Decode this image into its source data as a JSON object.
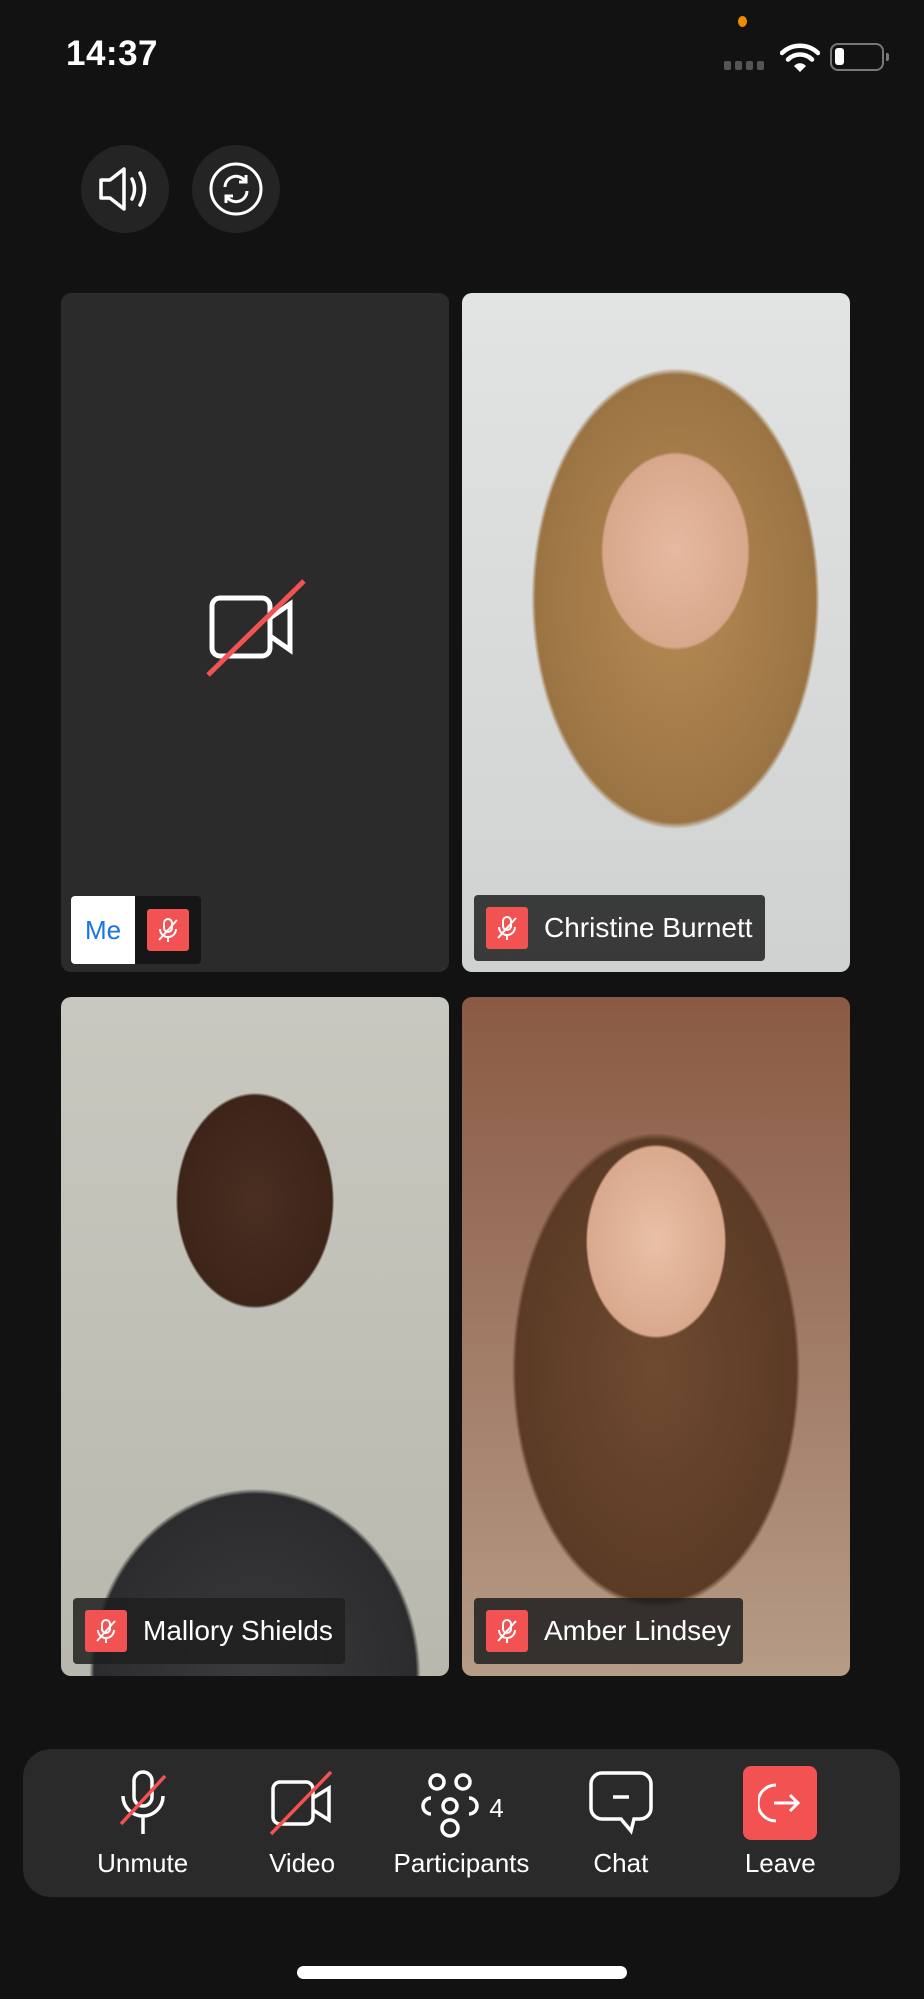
{
  "status_bar": {
    "time": "14:37",
    "icons": [
      "signal-icon",
      "wifi-icon",
      "battery-icon"
    ],
    "battery_level": 0.15
  },
  "top_controls": [
    {
      "icon": "speaker-icon"
    },
    {
      "icon": "switch-camera-icon"
    }
  ],
  "tiles": [
    {
      "name": "Me",
      "video": false,
      "muted": true
    },
    {
      "name": "Christine Burnett",
      "video": true,
      "muted": true
    },
    {
      "name": "Mallory Shields",
      "video": true,
      "muted": true
    },
    {
      "name": "Amber Lindsey",
      "video": true,
      "muted": true
    }
  ],
  "toolbar": {
    "unmute": "Unmute",
    "video": "Video",
    "participants": "Participants",
    "participants_count": "4",
    "chat": "Chat",
    "leave": "Leave"
  },
  "colors": {
    "accent_red": "#f25252",
    "me_label": "#1a73e8",
    "background": "#121212",
    "toolbar": "#2a2a2a"
  }
}
